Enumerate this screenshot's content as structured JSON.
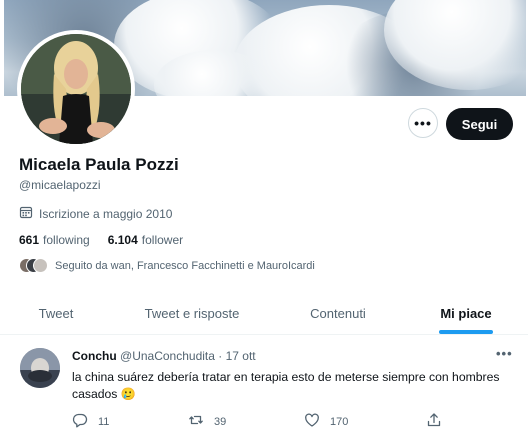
{
  "profile": {
    "display_name": "Micaela Paula Pozzi",
    "handle": "@micaelapozzi",
    "joined": "Iscrizione a maggio 2010",
    "following_count": "661",
    "following_label": "following",
    "follower_count": "6.104",
    "follower_label": "follower",
    "followed_by": "Seguito da wan, Francesco Facchinetti e MauroIcardi"
  },
  "actions": {
    "more_label": "•••",
    "follow_label": "Segui"
  },
  "tabs": [
    {
      "label": "Tweet",
      "active": false
    },
    {
      "label": "Tweet e risposte",
      "active": false
    },
    {
      "label": "Contenuti",
      "active": false
    },
    {
      "label": "Mi piace",
      "active": true
    }
  ],
  "tweet": {
    "author_name": "Conchu",
    "author_handle": "@UnaConchudita",
    "separator": "·",
    "date": "17 ott",
    "text": "la china suárez debería tratar en terapia esto de meterse siempre con hombres casados 🥲",
    "reply_count": "11",
    "retweet_count": "39",
    "like_count": "170",
    "more_label": "•••"
  },
  "colors": {
    "accent": "#1d9bf0",
    "text_primary": "#0f1419",
    "text_secondary": "#536471",
    "follow_button_bg": "#0f1419"
  },
  "icons": [
    "calendar-icon",
    "more-icon",
    "reply-icon",
    "retweet-icon",
    "like-icon",
    "share-icon"
  ]
}
